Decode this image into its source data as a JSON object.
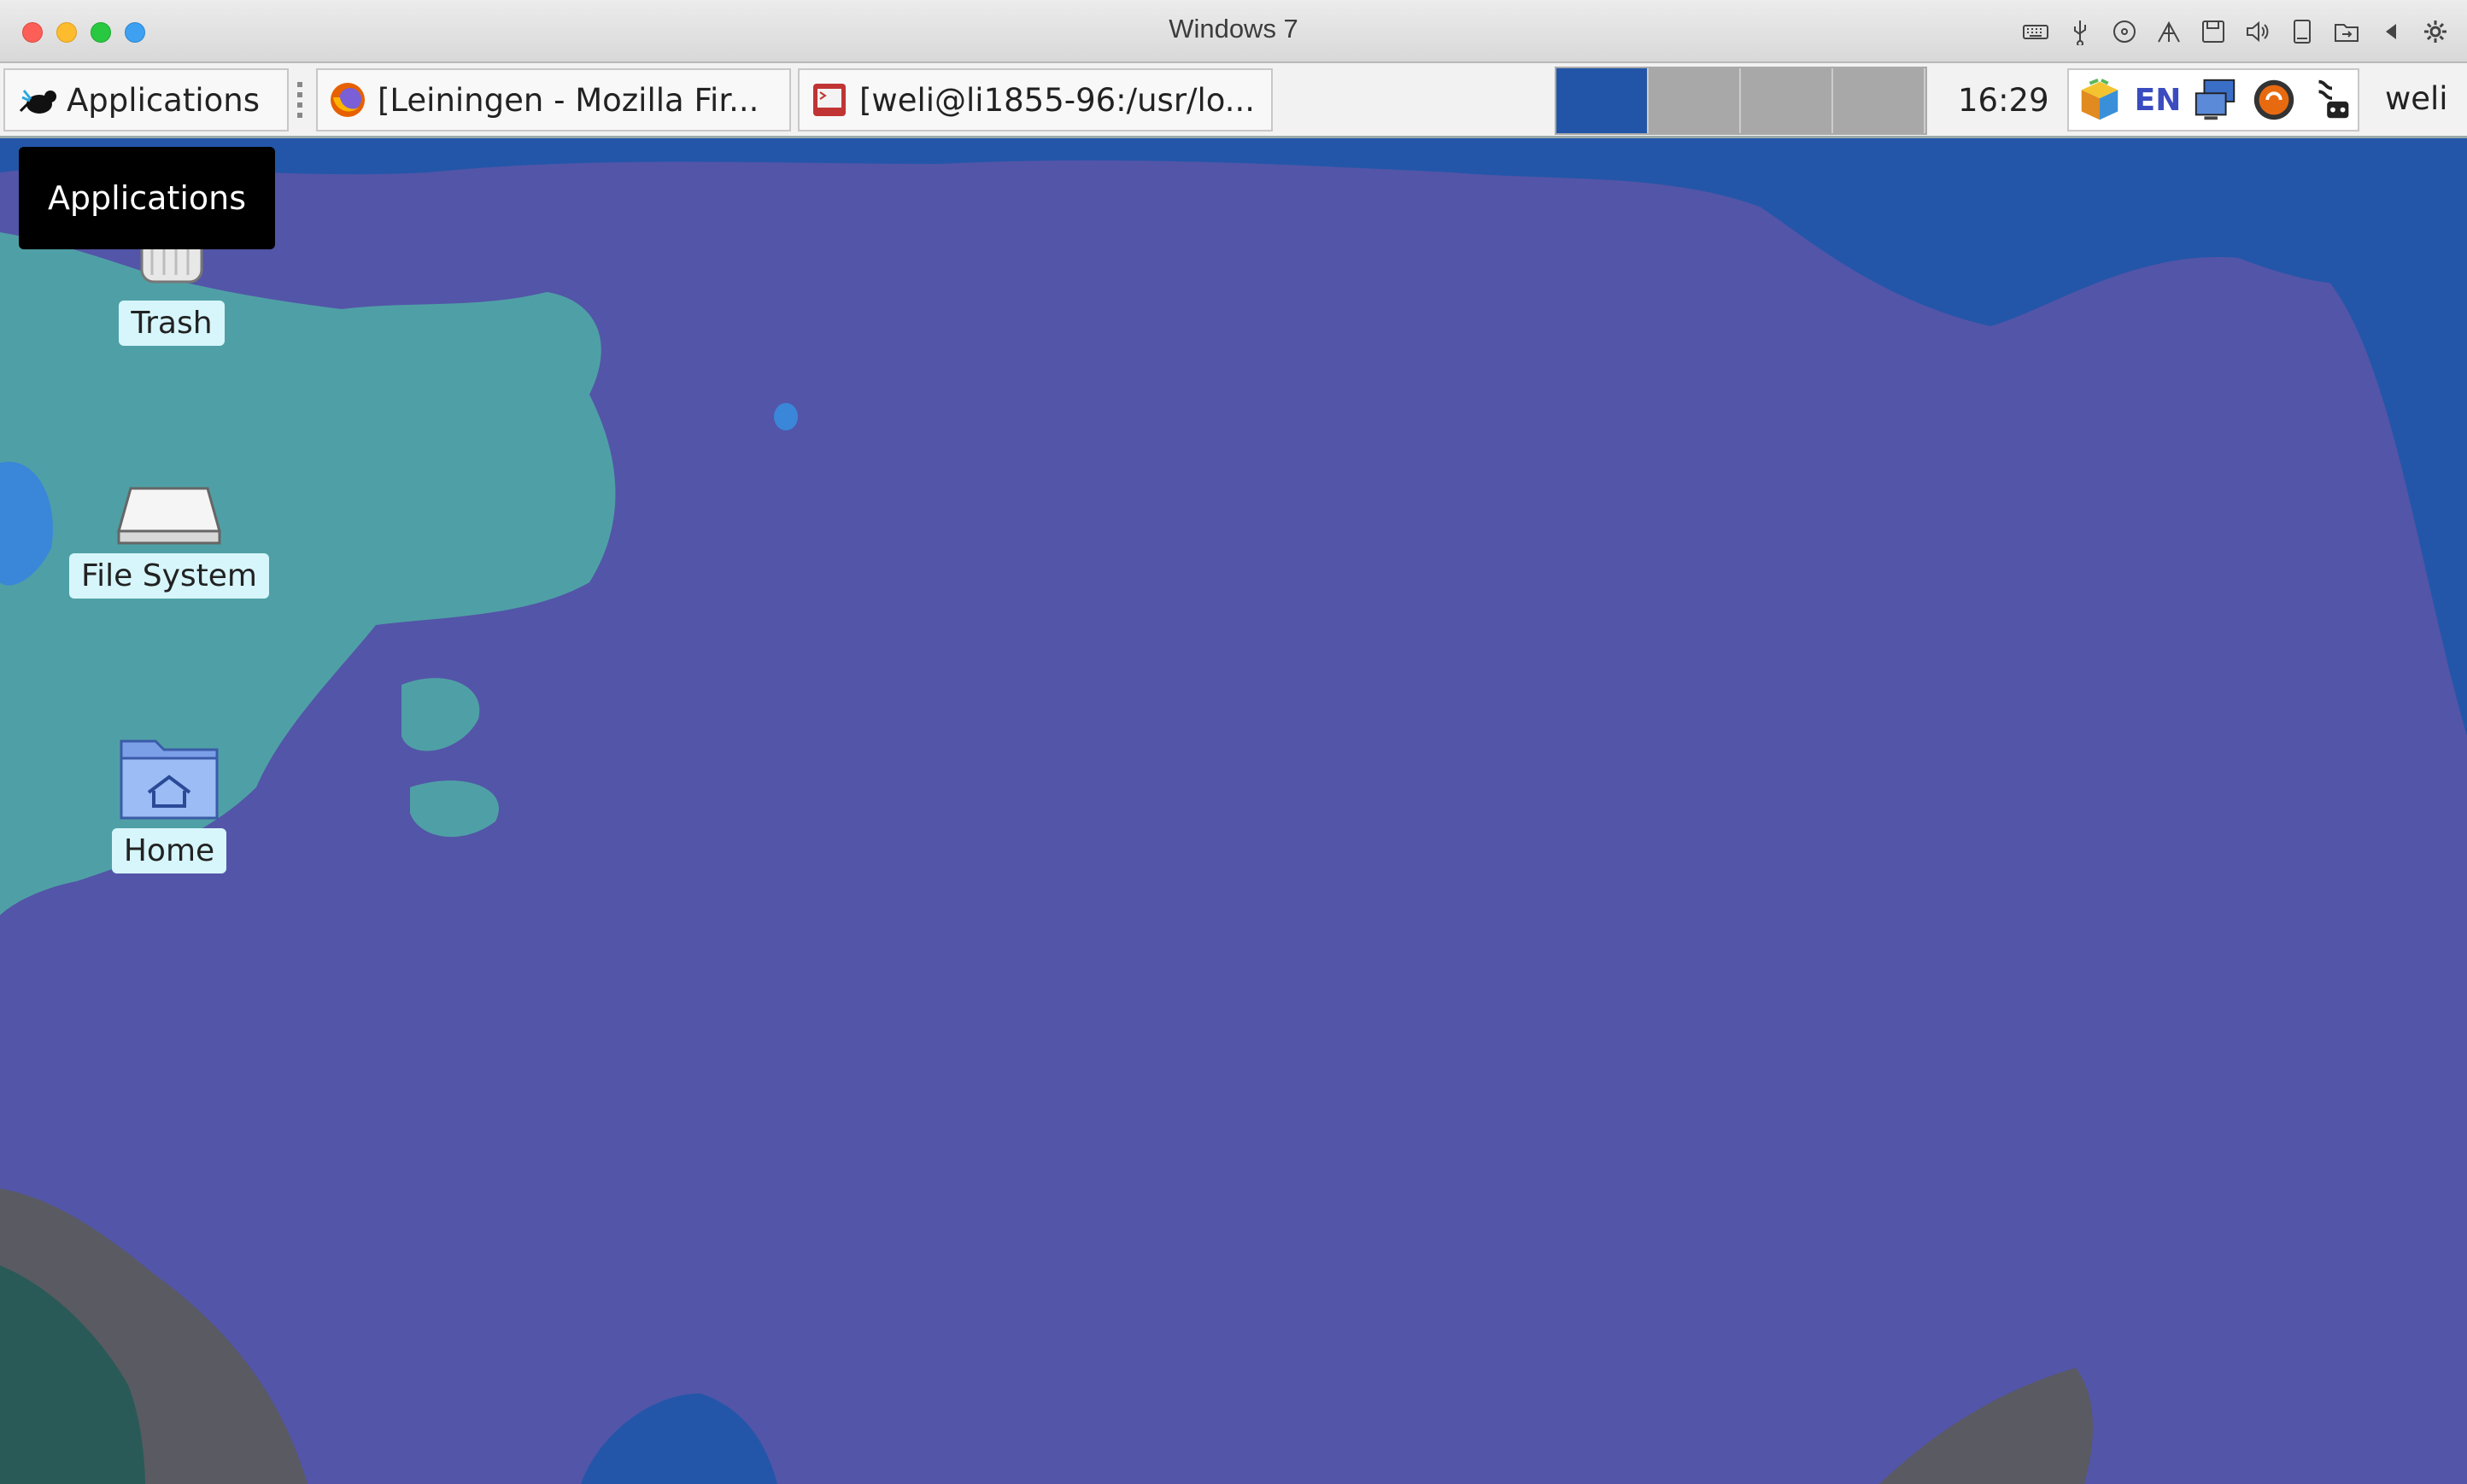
{
  "host": {
    "window_title": "Windows 7",
    "toolbar_icons": [
      "keyboard-icon",
      "usb-icon",
      "optical-drive-icon",
      "network-icon",
      "floppy-icon",
      "audio-icon",
      "disk-icon",
      "shared-folder-icon",
      "back-arrow-icon",
      "gear-icon"
    ]
  },
  "panel": {
    "applications_label": "Applications",
    "tasks": [
      {
        "label": "[Leiningen - Mozilla Fir...",
        "icon": "firefox-icon"
      },
      {
        "label": "[weli@li1855-96:/usr/lo...",
        "icon": "terminal-icon"
      }
    ],
    "workspaces": 4,
    "active_workspace": 1,
    "clock": "16:29",
    "tray": {
      "lang": "EN"
    },
    "user": "weli"
  },
  "tooltip": "Applications",
  "desktop": {
    "icons": [
      {
        "label": "Trash",
        "icon": "trash-icon"
      },
      {
        "label": "File System",
        "icon": "drive-icon"
      },
      {
        "label": "Home",
        "icon": "home-folder-icon"
      }
    ]
  },
  "colors": {
    "wallpaper_base": "#5355a8",
    "wallpaper_teal": "#4fa0a6",
    "wallpaper_blue": "#2356a8",
    "wallpaper_grey": "#5a5a62",
    "workspace_active": "#2255a8"
  }
}
